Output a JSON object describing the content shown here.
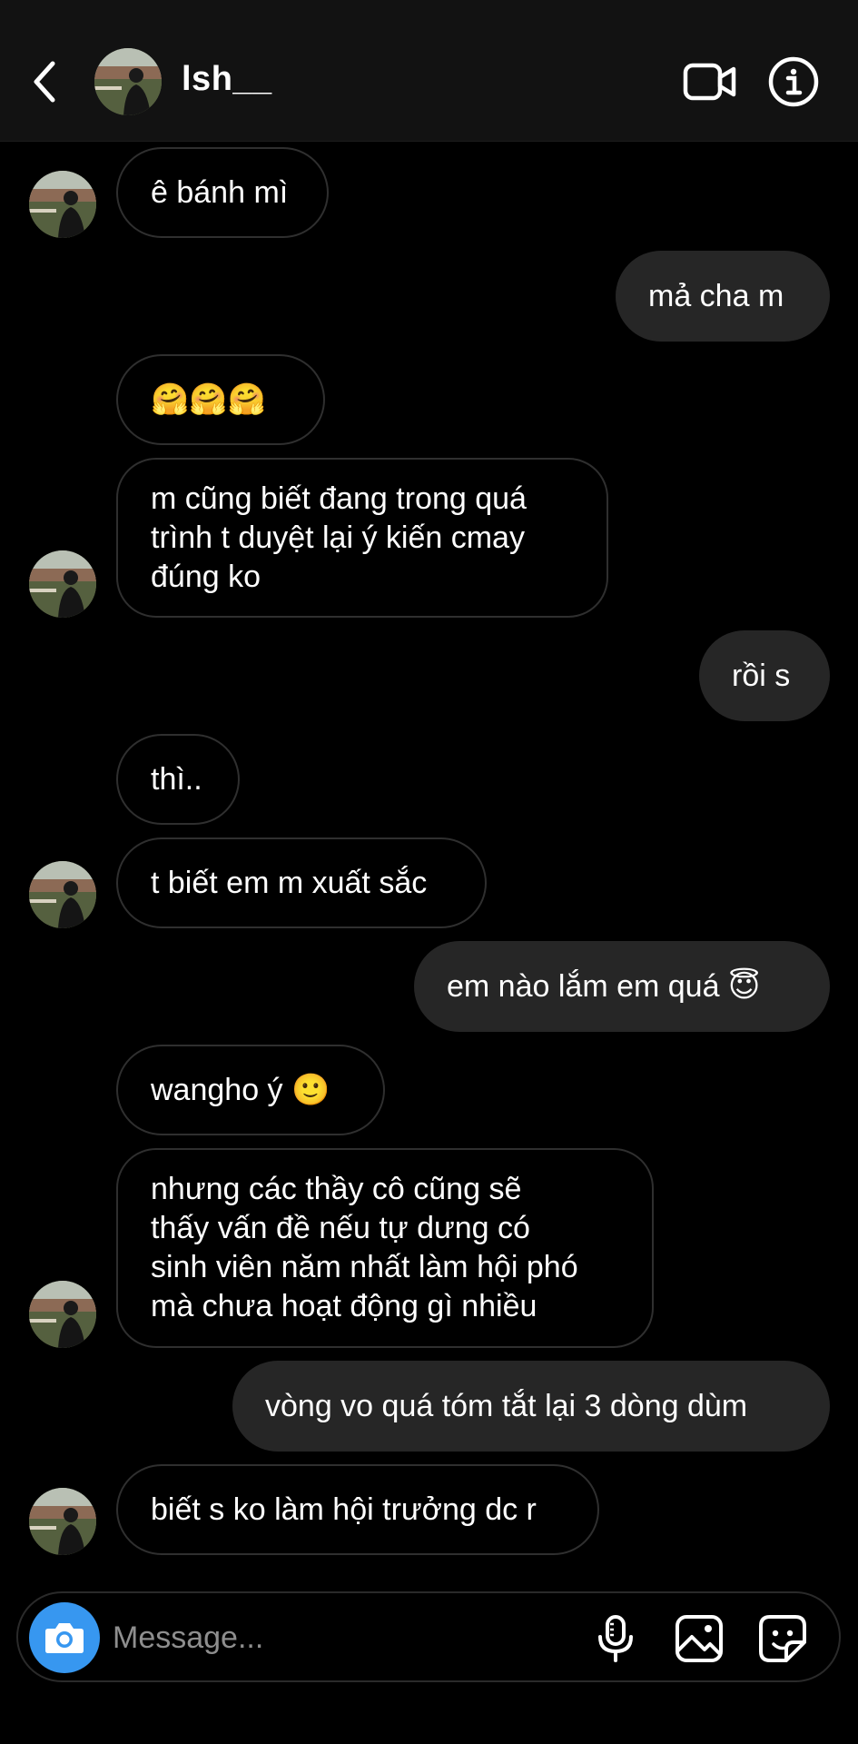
{
  "header": {
    "title": "lsh__",
    "back_icon": "chevron-left-icon",
    "video_icon": "video-call-icon",
    "info_icon": "info-icon"
  },
  "messages": [
    {
      "dir": "in",
      "text": "ê bánh mì"
    },
    {
      "dir": "out",
      "text": "mả cha m"
    },
    {
      "dir": "in",
      "text": "🤗🤗🤗"
    },
    {
      "dir": "in",
      "text": "m cũng biết đang trong quá\ntrình t duyệt lại ý kiến cmay\nđúng ko"
    },
    {
      "dir": "out",
      "text": "rồi s"
    },
    {
      "dir": "in",
      "text": "thì.."
    },
    {
      "dir": "in",
      "text": "t biết em m xuất sắc"
    },
    {
      "dir": "out",
      "text": "em nào lắm em quá 😇"
    },
    {
      "dir": "in",
      "text": "wangho ý 🙂"
    },
    {
      "dir": "in",
      "text": "nhưng các thầy cô cũng sẽ\nthấy vấn đề nếu tự dưng có\nsinh viên năm nhất làm hội phó\nmà chưa hoạt động gì nhiều"
    },
    {
      "dir": "out",
      "text": "vòng vo quá tóm tắt lại 3 dòng dùm"
    },
    {
      "dir": "in",
      "text": "biết s ko làm hội trưởng dc r"
    }
  ],
  "composer": {
    "placeholder": "Message...",
    "camera_icon": "camera-icon",
    "mic_icon": "microphone-icon",
    "gallery_icon": "gallery-icon",
    "sticker_icon": "sticker-icon"
  },
  "colors": {
    "background": "#000000",
    "header": "#121212",
    "outgoing_bubble": "#262626",
    "incoming_border": "#2f2f2f",
    "camera_button": "#3797f0",
    "placeholder": "#8e8e8e"
  }
}
